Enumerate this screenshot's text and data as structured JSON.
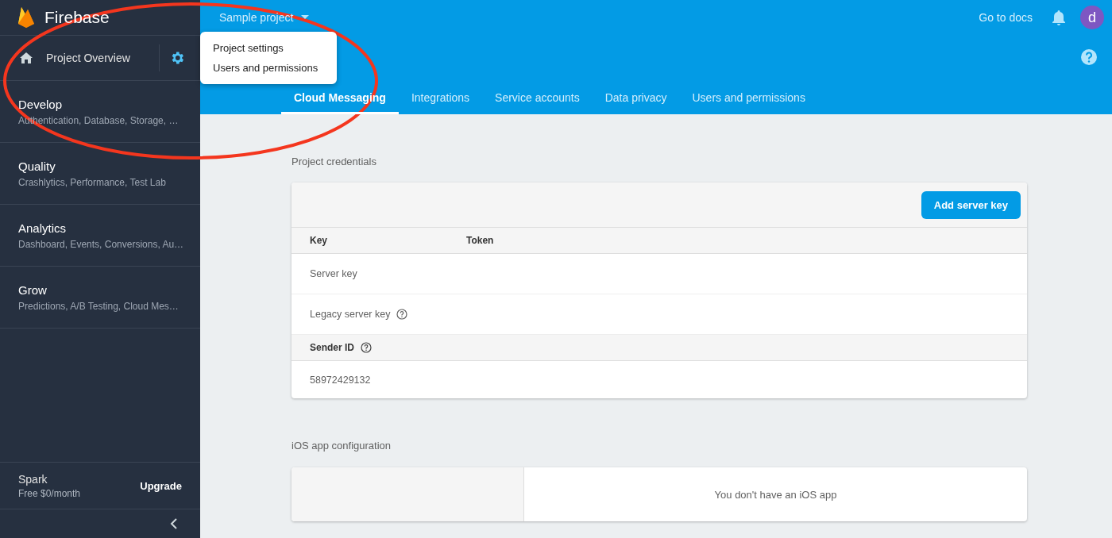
{
  "sidebar": {
    "brand": "Firebase",
    "overview": "Project Overview",
    "sections": [
      {
        "title": "Develop",
        "subtitle": "Authentication, Database, Storage, …"
      },
      {
        "title": "Quality",
        "subtitle": "Crashlytics, Performance, Test Lab"
      },
      {
        "title": "Analytics",
        "subtitle": "Dashboard, Events, Conversions, Au…"
      },
      {
        "title": "Grow",
        "subtitle": "Predictions, A/B Testing, Cloud Mes…"
      }
    ],
    "plan": {
      "name": "Spark",
      "price": "Free $0/month",
      "action": "Upgrade"
    }
  },
  "topbar": {
    "project": "Sample project",
    "docs": "Go to docs",
    "avatar": "d"
  },
  "menu": [
    "Project settings",
    "Users and permissions"
  ],
  "tabs": [
    {
      "label": "Cloud Messaging",
      "selected": true
    },
    {
      "label": "Integrations",
      "selected": false
    },
    {
      "label": "Service accounts",
      "selected": false
    },
    {
      "label": "Data privacy",
      "selected": false
    },
    {
      "label": "Users and permissions",
      "selected": false
    }
  ],
  "credentials": {
    "title": "Project credentials",
    "button": "Add server key",
    "columns": [
      "Key",
      "Token"
    ],
    "rows": [
      {
        "key": "Server key",
        "help": false
      },
      {
        "key": "Legacy server key",
        "help": true
      }
    ],
    "sender_label": "Sender ID",
    "sender_id": "58972429132"
  },
  "ios": {
    "title": "iOS app configuration",
    "message": "You don't have an iOS app"
  }
}
